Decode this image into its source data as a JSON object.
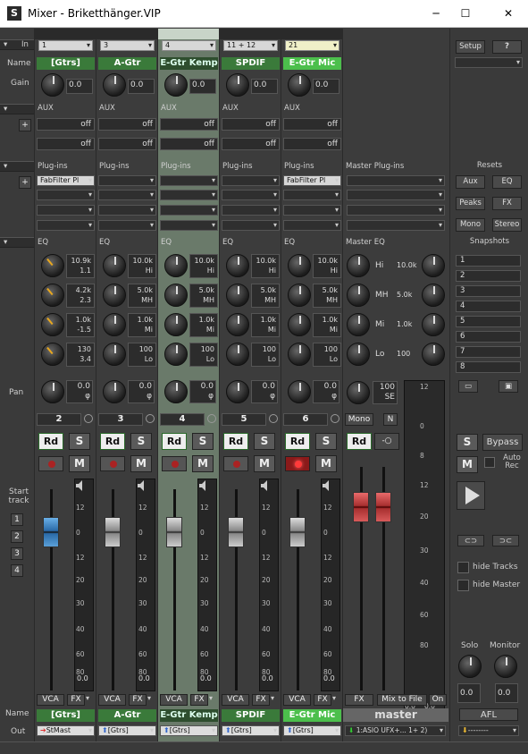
{
  "window": {
    "title": "Mixer - Briketthänger.VIP",
    "minimize": "─",
    "maximize": "☐",
    "close": "✕"
  },
  "row_labels": {
    "in": "In",
    "name": "Name",
    "gain": "Gain",
    "aux": "AUX",
    "plugins": "Plug-ins",
    "eq": "EQ",
    "pan": "Pan",
    "start_track": "Start track",
    "name_bottom": "Name",
    "out": "Out"
  },
  "channels": [
    {
      "num": "2",
      "input": "1",
      "name": "[Gtrs]",
      "gain": "0.0",
      "aux1": "off",
      "aux2": "off",
      "plugin": "FabFilter Pl",
      "eq": {
        "hi_f": "10.9k",
        "hi_g": "1.1",
        "mh_f": "4.2k",
        "mh_g": "2.3",
        "mi_f": "1.0k",
        "mi_g": "-1.5",
        "lo_f": "130",
        "lo_g": "3.4"
      },
      "pan": "0.0",
      "pan_sym": "φ",
      "rd": "Rd",
      "solo": "S",
      "mute": "M",
      "vca": "VCA",
      "fx": "FX",
      "name_bottom": "[Gtrs]",
      "out": "StMast",
      "meter_val": "0.0"
    },
    {
      "num": "3",
      "input": "3",
      "name": "A-Gtr",
      "gain": "0.0",
      "aux1": "off",
      "aux2": "off",
      "plugin": "",
      "eq": {
        "hi_f": "10.0k",
        "hi_g": "Hi",
        "mh_f": "5.0k",
        "mh_g": "MH",
        "mi_f": "1.0k",
        "mi_g": "Mi",
        "lo_f": "100",
        "lo_g": "Lo"
      },
      "pan": "0.0",
      "pan_sym": "φ",
      "rd": "Rd",
      "solo": "S",
      "mute": "M",
      "vca": "VCA",
      "fx": "FX",
      "name_bottom": "A-Gtr",
      "out": "[Gtrs]",
      "meter_val": "0.0"
    },
    {
      "num": "4",
      "input": "4",
      "name": "E-Gtr Kemp",
      "gain": "0.0",
      "aux1": "off",
      "aux2": "off",
      "plugin": "",
      "eq": {
        "hi_f": "10.0k",
        "hi_g": "Hi",
        "mh_f": "5.0k",
        "mh_g": "MH",
        "mi_f": "1.0k",
        "mi_g": "Mi",
        "lo_f": "100",
        "lo_g": "Lo"
      },
      "pan": "0.0",
      "pan_sym": "φ",
      "rd": "Rd",
      "solo": "S",
      "mute": "M",
      "vca": "VCA",
      "fx": "FX",
      "name_bottom": "E-Gtr Kemp",
      "out": "[Gtrs]",
      "meter_val": "0.0"
    },
    {
      "num": "5",
      "input": "11 + 12",
      "name": "SPDIF",
      "gain": "0.0",
      "aux1": "off",
      "aux2": "off",
      "plugin": "",
      "eq": {
        "hi_f": "10.0k",
        "hi_g": "Hi",
        "mh_f": "5.0k",
        "mh_g": "MH",
        "mi_f": "1.0k",
        "mi_g": "Mi",
        "lo_f": "100",
        "lo_g": "Lo"
      },
      "pan": "0.0",
      "pan_sym": "φ",
      "rd": "Rd",
      "solo": "S",
      "mute": "M",
      "vca": "VCA",
      "fx": "FX",
      "name_bottom": "SPDIF",
      "out": "[Gtrs]",
      "meter_val": "0.0"
    },
    {
      "num": "6",
      "input": "21",
      "name": "E-Gtr Mic",
      "gain": "0.0",
      "aux1": "off",
      "aux2": "off",
      "plugin": "FabFilter Pl",
      "eq": {
        "hi_f": "10.0k",
        "hi_g": "Hi",
        "mh_f": "5.0k",
        "mh_g": "MH",
        "mi_f": "1.0k",
        "mi_g": "Mi",
        "lo_f": "100",
        "lo_g": "Lo"
      },
      "pan": "0.0",
      "pan_sym": "φ",
      "rd": "Rd",
      "solo": "S",
      "mute": "M",
      "vca": "VCA",
      "fx": "FX",
      "name_bottom": "E-Gtr Mic",
      "out": "[Gtrs]",
      "meter_val": "0.0"
    }
  ],
  "master": {
    "plugins_label": "Master Plug-ins",
    "eq_label": "Master EQ",
    "eq": [
      {
        "band": "Hi",
        "val": "10.0k"
      },
      {
        "band": "MH",
        "val": "5.0k"
      },
      {
        "band": "Mi",
        "val": "1.0k"
      },
      {
        "band": "Lo",
        "val": "100"
      }
    ],
    "pan": "100",
    "pan_mode": "SE",
    "mono": "Mono",
    "n": "N",
    "rd": "Rd",
    "fx": "FX",
    "mix_to_file": "Mix to File",
    "on": "On",
    "name": "master",
    "out": "1:ASIO UFX+... 1+ 2)",
    "meter_left": "0.0",
    "meter_right": "0.0"
  },
  "meter_scale": [
    "12",
    "0",
    "12",
    "20",
    "30",
    "40",
    "60",
    "80"
  ],
  "master_scale": [
    "12",
    "0",
    "8",
    "12",
    "20",
    "30",
    "40",
    "60",
    "80"
  ],
  "side": {
    "setup": "Setup",
    "help": "?",
    "resets": "Resets",
    "aux": "Aux",
    "eq": "EQ",
    "peaks": "Peaks",
    "fx": "FX",
    "mono": "Mono",
    "stereo": "Stereo",
    "snapshots": "Snapshots",
    "snaps": [
      "1",
      "2",
      "3",
      "4",
      "5",
      "6",
      "7",
      "8"
    ],
    "solo": "S",
    "bypass": "Bypass",
    "mute": "M",
    "auto_rec": "Auto Rec",
    "hide_tracks": "hide Tracks",
    "hide_master": "hide Master",
    "solo_label": "Solo",
    "monitor_label": "Monitor",
    "solo_val": "0.0",
    "monitor_val": "0.0",
    "afl": "AFL",
    "out": "--------"
  },
  "start_tracks": [
    "1",
    "2",
    "3",
    "4"
  ],
  "colors": {
    "name_green": "#3a7a3a",
    "bright_green": "#4cbf4c",
    "fader_blue": "#2a6aa8",
    "fader_red": "#a83030",
    "rec_red": "#ff3a3a"
  }
}
